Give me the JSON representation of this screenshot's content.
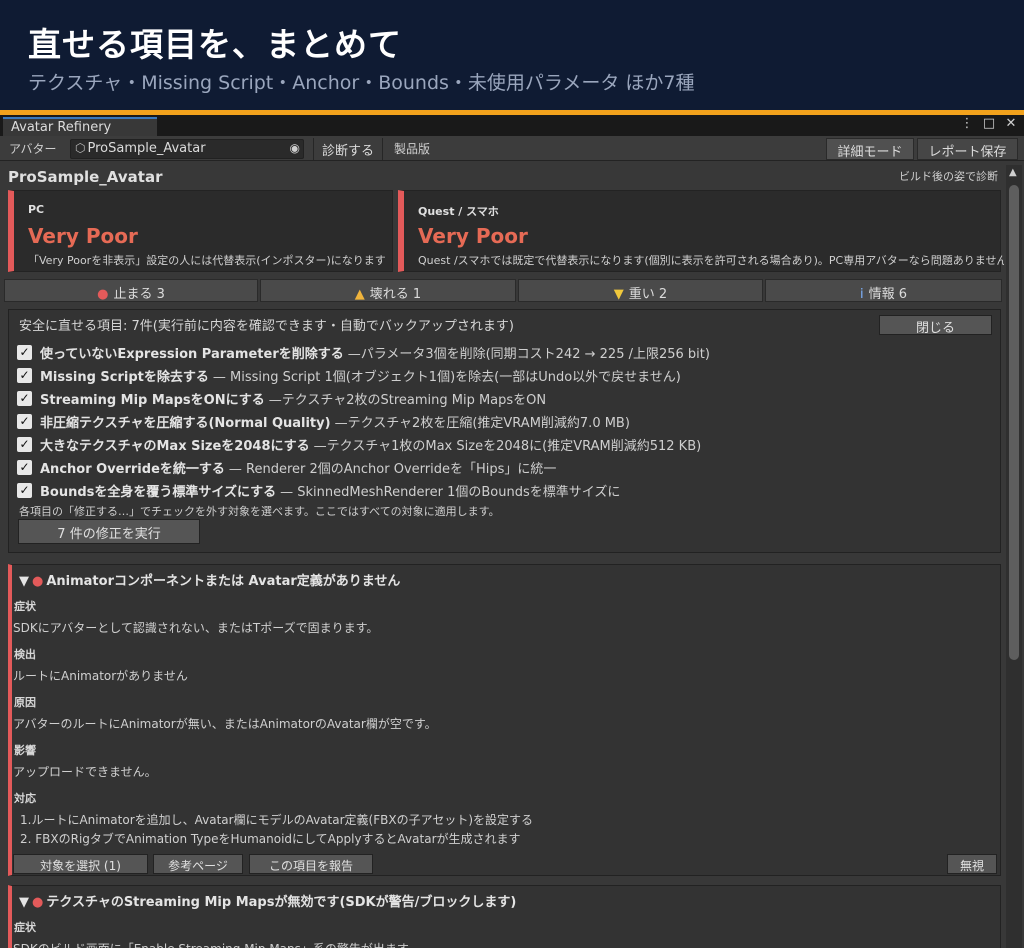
{
  "banner": {
    "title": "直せる項目を、まとめて",
    "subtitle": "テクスチャ・Missing Script・Anchor・Bounds・未使用パラメータ ほか7種"
  },
  "window": {
    "tab_title": "Avatar Refinery",
    "controls": [
      "⋮",
      "□",
      "✕"
    ]
  },
  "toolbar": {
    "avatar_label": "アバター",
    "avatar_value": "ProSample_Avatar",
    "diagnose_label": "診断する",
    "edition_text": "製品版",
    "detail_mode_label": "詳細モード",
    "save_report_label": "レポート保存"
  },
  "summary": {
    "avatar_name": "ProSample_Avatar",
    "build_note": "ビルド後の姿で診断",
    "pc": {
      "platform": "PC",
      "rank": "Very Poor",
      "note": "「Very Poorを非表示」設定の人には代替表示(インポスター)になります"
    },
    "quest": {
      "platform": "Quest / スマホ",
      "rank": "Very Poor",
      "note": "Quest /スマホでは既定で代替表示になります(個別に表示を許可される場合あり)。PC専用アバターなら問題ありません"
    }
  },
  "count_tabs": [
    {
      "symbol": "●",
      "label": "止まる 3",
      "color": "#e35a5a"
    },
    {
      "symbol": "▲",
      "label": "壊れる 1",
      "color": "#f0b43c"
    },
    {
      "symbol": "▼",
      "label": "重い 2",
      "color": "#f0c83c"
    },
    {
      "symbol": "i",
      "label": "情報 6",
      "color": "#7fb3ff"
    }
  ],
  "fixes": {
    "header": "安全に直せる項目: 7件(実行前に内容を確認できます・自動でバックアップされます)",
    "close_label": "閉じる",
    "items": [
      {
        "title": "使っていないExpression Parameterを削除する",
        "desc": "—パラメータ3個を削除(同期コスト242 → 225 /上限256 bit)"
      },
      {
        "title": "Missing Scriptを除去する",
        "desc": "— Missing Script 1個(オブジェクト1個)を除去(一部はUndo以外で戻せません)"
      },
      {
        "title": "Streaming Mip MapsをONにする",
        "desc": "—テクスチャ2枚のStreaming Mip MapsをON"
      },
      {
        "title": "非圧縮テクスチャを圧縮する(Normal Quality)",
        "desc": "—テクスチャ2枚を圧縮(推定VRAM削減約7.0 MB)"
      },
      {
        "title": "大きなテクスチャのMax Sizeを2048にする",
        "desc": "—テクスチャ1枚のMax Sizeを2048に(推定VRAM削減約512 KB)"
      },
      {
        "title": "Anchor Overrideを統一する",
        "desc": "— Renderer 2個のAnchor Overrideを「Hips」に統一"
      },
      {
        "title": "Boundsを全身を覆う標準サイズにする",
        "desc": "— SkinnedMeshRenderer 1個のBoundsを標準サイズに"
      }
    ],
    "footnote": "各項目の「修正する…」でチェックを外す対象を選べます。ここではすべての対象に適用します。",
    "run_label": "7 件の修正を実行"
  },
  "issues": [
    {
      "title": "Animatorコンポーネントまたは Avatar定義がありません",
      "symptom_label": "症状",
      "symptom": "SDKにアバターとして認識されない、またはTポーズで固まります。",
      "detect_label": "検出",
      "detect": "ルートにAnimatorがありません",
      "cause_label": "原因",
      "cause": "アバターのルートにAnimatorが無い、またはAnimatorのAvatar欄が空です。",
      "impact_label": "影響",
      "impact": "アップロードできません。",
      "fix_label": "対応",
      "fix_steps": [
        "1.ルートにAnimatorを追加し、Avatar欄にモデルのAvatar定義(FBXの子アセット)を設定する",
        "2. FBXのRigタブでAnimation TypeをHumanoidにしてApplyするとAvatarが生成されます"
      ],
      "buttons": {
        "select": "対象を選択 (1)",
        "reference": "参考ページ",
        "report": "この項目を報告",
        "ignore": "無視"
      }
    },
    {
      "title": "テクスチャのStreaming Mip Mapsが無効です(SDKが警告/ブロックします)",
      "symptom_label": "症状",
      "symptom": "SDKのビルド画面に「Enable Streaming Mip Maps」系の警告が出ます"
    }
  ]
}
